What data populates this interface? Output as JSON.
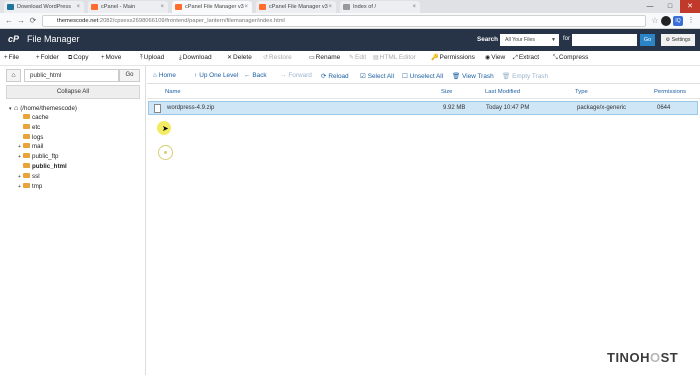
{
  "browser": {
    "tabs": [
      {
        "label": "Download WordPress",
        "fav_color": "#21759b"
      },
      {
        "label": "cPanel - Main",
        "fav_color": "#ff6c2c"
      },
      {
        "label": "cPanel File Manager v3",
        "fav_color": "#ff6c2c"
      },
      {
        "label": "cPanel File Manager v3",
        "fav_color": "#ff6c2c"
      },
      {
        "label": "Index of /",
        "fav_color": "#999999"
      }
    ],
    "close_glyph": "×",
    "url_host": "themescode.net",
    "url_rest": ":2082/cpsess2698066109/frontend/paper_lantern/filemanager/index.html",
    "nav": {
      "back": "←",
      "forward": "→",
      "reload": "⟳"
    },
    "window_buttons": {
      "min": "—",
      "max": "□",
      "close": "✕"
    }
  },
  "cpanel": {
    "logo": "cP",
    "title": "File Manager",
    "search_label": "Search",
    "search_select": "All Your Files",
    "for_label": "for",
    "go_label": "Go",
    "settings_label": "⚙ Settings"
  },
  "toolbar": [
    {
      "icon": "+",
      "label": "File",
      "disabled": false
    },
    {
      "icon": "+",
      "label": "Folder",
      "disabled": false
    },
    {
      "icon": "⧉",
      "label": "Copy",
      "disabled": false
    },
    {
      "icon": "+",
      "label": "Move",
      "disabled": false
    },
    {
      "icon": "⤒",
      "label": "Upload",
      "disabled": false
    },
    {
      "icon": "⤓",
      "label": "Download",
      "disabled": false
    },
    {
      "icon": "✕",
      "label": "Delete",
      "disabled": false
    },
    {
      "icon": "↺",
      "label": "Restore",
      "disabled": true
    },
    {
      "icon": "▭",
      "label": "Rename",
      "disabled": false
    },
    {
      "icon": "✎",
      "label": "Edit",
      "disabled": true
    },
    {
      "icon": "▤",
      "label": "HTML Editor",
      "disabled": true
    },
    {
      "icon": "🔑",
      "label": "Permissions",
      "disabled": false
    },
    {
      "icon": "◉",
      "label": "View",
      "disabled": false
    },
    {
      "icon": "⤢",
      "label": "Extract",
      "disabled": false
    },
    {
      "icon": "⤡",
      "label": "Compress",
      "disabled": false
    }
  ],
  "left": {
    "path_value": "public_html",
    "go_label": "Go",
    "collapse_label": "Collapse All",
    "root_label": "(/home/themescode)",
    "tree": [
      {
        "label": "cache",
        "expandable": false,
        "bold": false
      },
      {
        "label": "etc",
        "expandable": false,
        "bold": false
      },
      {
        "label": "logs",
        "expandable": false,
        "bold": false
      },
      {
        "label": "mail",
        "expandable": true,
        "bold": false
      },
      {
        "label": "public_ftp",
        "expandable": true,
        "bold": false
      },
      {
        "label": "public_html",
        "expandable": false,
        "bold": true
      },
      {
        "label": "ssl",
        "expandable": true,
        "bold": false
      },
      {
        "label": "tmp",
        "expandable": true,
        "bold": false
      }
    ]
  },
  "nav": [
    {
      "icon": "⌂",
      "label": "Home",
      "disabled": false
    },
    {
      "icon": "↑",
      "label": "Up One Level",
      "disabled": false
    },
    {
      "icon": "←",
      "label": "Back",
      "disabled": false
    },
    {
      "icon": "→",
      "label": "Forward",
      "disabled": true
    },
    {
      "icon": "⟳",
      "label": "Reload",
      "disabled": false
    },
    {
      "icon": "☑",
      "label": "Select All",
      "disabled": false
    },
    {
      "icon": "☐",
      "label": "Unselect All",
      "disabled": false
    },
    {
      "icon": "🗑",
      "label": "View Trash",
      "disabled": false
    },
    {
      "icon": "🗑",
      "label": "Empty Trash",
      "disabled": true
    }
  ],
  "columns": {
    "name": "Name",
    "size": "Size",
    "modified": "Last Modified",
    "type": "Type",
    "perms": "Permissions"
  },
  "file": {
    "name": "wordpress-4.9.zip",
    "size": "9.92 MB",
    "modified": "Today 10:47 PM",
    "type": "package/x-generic",
    "perms": "0644"
  },
  "watermark": {
    "a": "TINO",
    "b": "H",
    "c": "O",
    "d": "ST"
  }
}
